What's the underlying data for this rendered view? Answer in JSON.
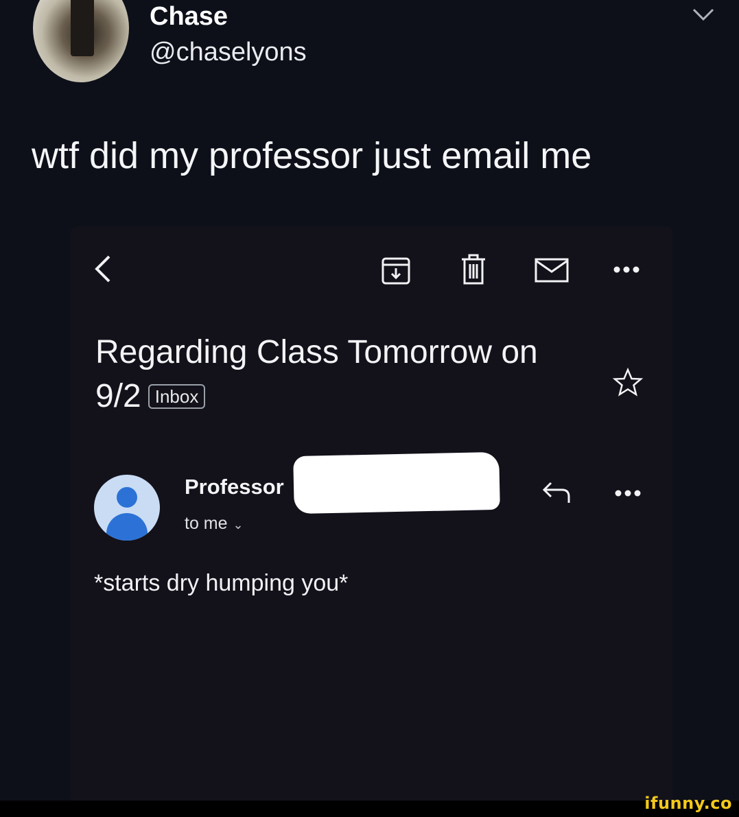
{
  "tweet": {
    "author_name": "Chase",
    "author_handle": "@chaselyons",
    "text": "wtf did my professor just email me"
  },
  "email": {
    "toolbar_icons": [
      "back-icon",
      "archive-icon",
      "trash-icon",
      "mail-icon",
      "more-icon"
    ],
    "subject": "Regarding Class Tomorrow on 9/2",
    "label_badge": "Inbox",
    "sender_name": "Professor",
    "recipient_line": "to me",
    "body": "*starts dry humping you*"
  },
  "watermark": "ifunny.co",
  "colors": {
    "background": "#0d1019",
    "email_background": "#13121b",
    "avatar_blue": "#2c72d6",
    "watermark_yellow": "#f2c81c"
  }
}
